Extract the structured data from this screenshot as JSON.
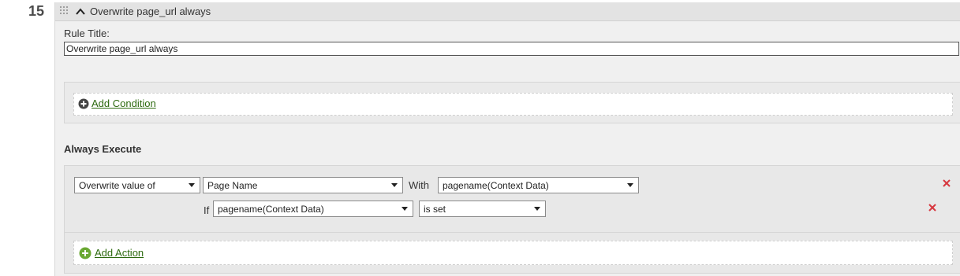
{
  "rule": {
    "number": "15",
    "header_title": "Overwrite page_url always",
    "title_label": "Rule Title:",
    "title_value": "Overwrite page_url always"
  },
  "conditions": {
    "add_label": "Add Condition"
  },
  "always_execute": {
    "heading": "Always Execute",
    "action": {
      "operation": "Overwrite value of",
      "target": "Page Name",
      "with_label": "With",
      "value": "pagename(Context Data)",
      "if_label": "If",
      "if_variable": "pagename(Context Data)",
      "if_operator": "is set"
    },
    "add_action_label": "Add Action"
  },
  "colors": {
    "link_green": "#2d6a0f",
    "add_action_icon": "#6aa832",
    "delete_red": "#d7373f"
  },
  "icons": [
    "drag-handle-icon",
    "chevron-up-icon",
    "plus-circle-icon",
    "close-icon",
    "dropdown-caret-icon"
  ]
}
